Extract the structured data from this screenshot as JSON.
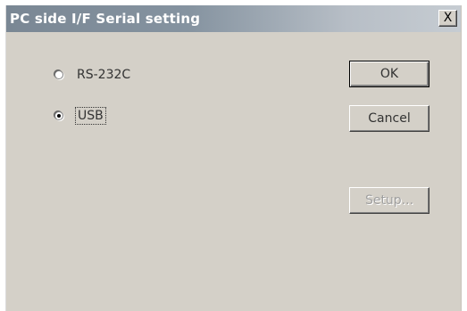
{
  "window": {
    "title": "PC side I/F  Serial setting",
    "close_glyph": "X"
  },
  "options": [
    {
      "label": "RS-232C",
      "selected": false
    },
    {
      "label": "USB",
      "selected": true
    }
  ],
  "buttons": {
    "ok_label": "OK",
    "cancel_label": "Cancel",
    "setup_label": "Setup...",
    "setup_enabled": false
  },
  "icons": {
    "close": "close-icon",
    "radio": "radio-button-icon"
  }
}
